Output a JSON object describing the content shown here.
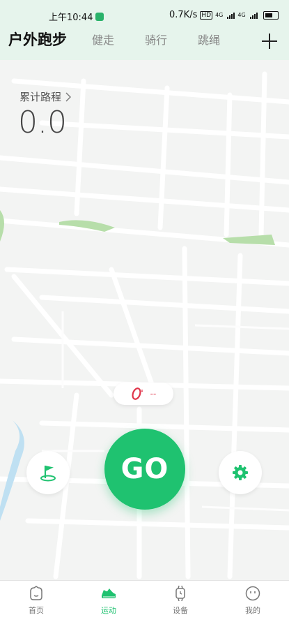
{
  "status_bar": {
    "time": "上午10:44",
    "network_speed": "0.7K/s",
    "hd": "HD",
    "signal1": "4G",
    "signal2": "4G",
    "battery": "60"
  },
  "sport_tabs": [
    {
      "label": "户外跑步",
      "active": true
    },
    {
      "label": "健走",
      "active": false
    },
    {
      "label": "骑行",
      "active": false
    },
    {
      "label": "跳绳",
      "active": false
    }
  ],
  "distance": {
    "label": "累计路程",
    "value": "0.0"
  },
  "gps": {
    "text": "--"
  },
  "go_button": {
    "label": "GO"
  },
  "bottom_nav": [
    {
      "label": "首页",
      "icon": "home-face-icon",
      "active": false
    },
    {
      "label": "运动",
      "icon": "shoe-icon",
      "active": true
    },
    {
      "label": "设备",
      "icon": "watch-icon",
      "active": false
    },
    {
      "label": "我的",
      "icon": "profile-face-icon",
      "active": false
    }
  ],
  "colors": {
    "accent": "#1fc270",
    "header_bg": "#e6f4ec",
    "gps_red": "#e0354a",
    "map_bg": "#f3f4f3"
  }
}
